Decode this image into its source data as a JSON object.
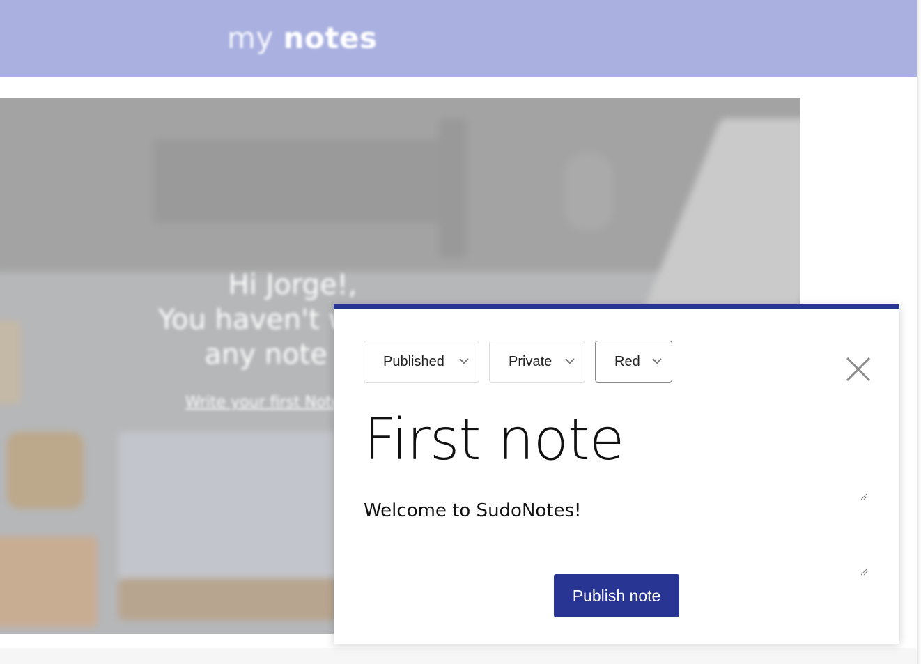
{
  "header": {
    "logo_light": "my",
    "logo_bold": "notes",
    "color": "#aab1e1"
  },
  "hero": {
    "greeting_line1": "Hi Jorge!,",
    "greeting_line2": "You haven't written",
    "greeting_line3": "any note yet",
    "link_text": "Write your first Note"
  },
  "modal": {
    "accent_color": "#283593",
    "status_select": {
      "value": "Published",
      "icon": "chevron-down-icon"
    },
    "visibility_select": {
      "value": "Private",
      "icon": "chevron-down-icon"
    },
    "color_select": {
      "value": "Red",
      "icon": "chevron-down-icon"
    },
    "close_icon": "close-icon",
    "title_value": "First note",
    "body_value": "Welcome to SudoNotes!",
    "publish_label": "Publish note"
  }
}
